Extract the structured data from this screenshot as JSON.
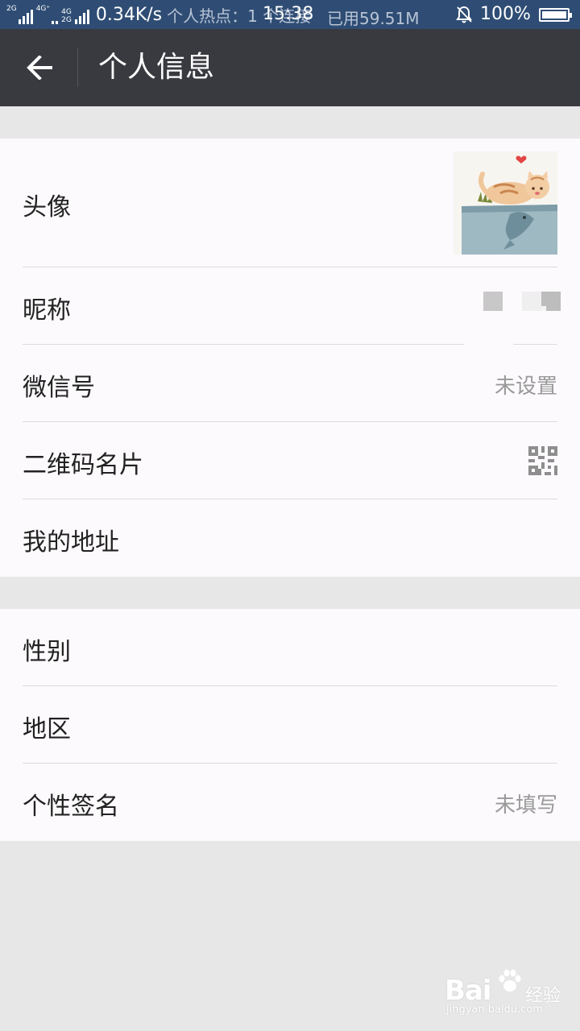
{
  "status_bar": {
    "net_left": "2G",
    "net_mid_top": "4G⁺",
    "net_right_top": "4G",
    "net_right_bottom": "2G",
    "speed": "0.34K/s",
    "hotspot": "个人热点：1 个连接",
    "time": "15:38",
    "used": "已用59.51M",
    "battery": "100%",
    "background_color": "#2f4d74"
  },
  "header": {
    "title": "个人信息",
    "back_icon": "arrow-left-icon",
    "background_color": "#393a3f"
  },
  "group1": {
    "avatar": {
      "label": "头像"
    },
    "nickname": {
      "label": "昵称"
    },
    "wechat_id": {
      "label": "微信号",
      "value": "未设置"
    },
    "qr_card": {
      "label": "二维码名片",
      "icon": "qr-code-icon"
    },
    "address": {
      "label": "我的地址"
    }
  },
  "group2": {
    "gender": {
      "label": "性别"
    },
    "region": {
      "label": "地区"
    },
    "signature": {
      "label": "个性签名",
      "value": "未填写"
    }
  },
  "watermark": {
    "logo": "Bai",
    "tail": "经验",
    "url": "jingyan.baidu.com"
  }
}
